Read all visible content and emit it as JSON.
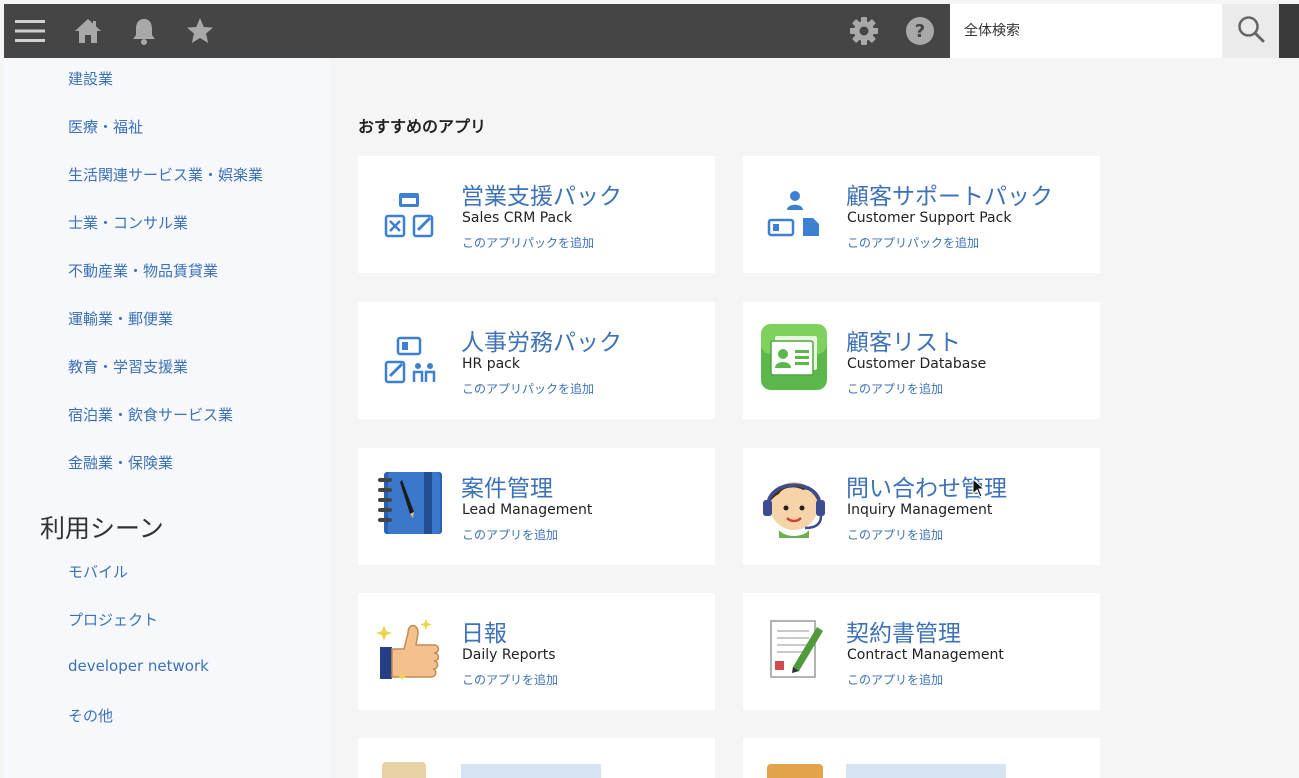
{
  "header": {
    "menu_icon": "hamburger-menu-icon",
    "home_icon": "home-icon",
    "bell_icon": "bell-icon",
    "star_icon": "star-icon",
    "gear_icon": "gear-icon",
    "help_icon": "help-icon",
    "search_placeholder": "全体検索",
    "search_icon": "search-icon"
  },
  "sidebar": {
    "industries": [
      "建設業",
      "医療・福祉",
      "生活関連サービス業・娯楽業",
      "士業・コンサル業",
      "不動産業・物品賃貸業",
      "運輸業・郵便業",
      "教育・学習支援業",
      "宿泊業・飲食サービス業",
      "金融業・保険業"
    ],
    "scenes_heading": "利用シーン",
    "scenes": [
      "モバイル",
      "プロジェクト",
      "developer network",
      "その他"
    ]
  },
  "main": {
    "section_title": "おすすめのアプリ",
    "cards": [
      {
        "title": "営業支援パック",
        "subtitle": "Sales CRM Pack",
        "action": "このアプリパックを追加",
        "icon": "sales-pack-icon"
      },
      {
        "title": "顧客サポートパック",
        "subtitle": "Customer Support Pack",
        "action": "このアプリパックを追加",
        "icon": "support-pack-icon"
      },
      {
        "title": "人事労務パック",
        "subtitle": "HR pack",
        "action": "このアプリパックを追加",
        "icon": "hr-pack-icon"
      },
      {
        "title": "顧客リスト",
        "subtitle": "Customer Database",
        "action": "このアプリを追加",
        "icon": "customer-list-icon"
      },
      {
        "title": "案件管理",
        "subtitle": "Lead Management",
        "action": "このアプリを追加",
        "icon": "notebook-icon"
      },
      {
        "title": "問い合わせ管理",
        "subtitle": "Inquiry Management",
        "action": "このアプリを追加",
        "icon": "headset-operator-icon"
      },
      {
        "title": "日報",
        "subtitle": "Daily Reports",
        "action": "このアプリを追加",
        "icon": "thumbs-up-icon"
      },
      {
        "title": "契約書管理",
        "subtitle": "Contract Management",
        "action": "このアプリを追加",
        "icon": "contract-document-icon"
      }
    ]
  }
}
